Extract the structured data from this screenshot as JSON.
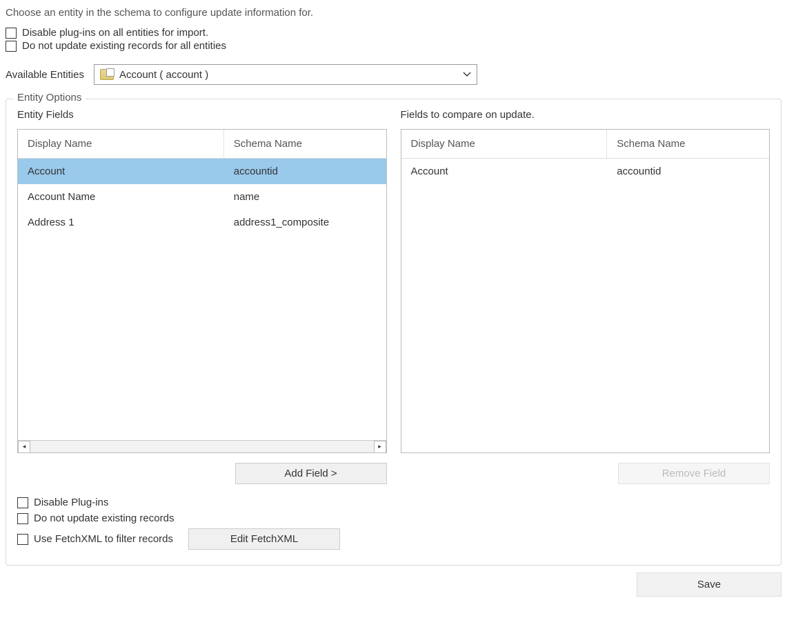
{
  "instruction": "Choose an entity in the schema to configure update information for.",
  "top_checks": {
    "disable_plugins_all": "Disable plug-ins on all entities for import.",
    "no_update_all": "Do not update existing records for all entities"
  },
  "available_entities": {
    "label": "Available Entities",
    "selected": "Account  ( account )"
  },
  "fieldset": {
    "legend": "Entity Options",
    "left": {
      "title": "Entity Fields",
      "headers": {
        "display": "Display Name",
        "schema": "Schema Name"
      },
      "rows": [
        {
          "display": "Account",
          "schema": "accountid",
          "selected": true
        },
        {
          "display": "Account Name",
          "schema": "name",
          "selected": false
        },
        {
          "display": "Address 1",
          "schema": "address1_composite",
          "selected": false
        }
      ],
      "button": "Add Field >"
    },
    "right": {
      "title": "Fields to compare on update.",
      "headers": {
        "display": "Display Name",
        "schema": "Schema Name"
      },
      "rows": [
        {
          "display": "Account",
          "schema": "accountid"
        }
      ],
      "button": "Remove Field",
      "button_disabled": true
    },
    "options": {
      "disable_plugins": "Disable Plug-ins",
      "no_update": "Do not update existing records",
      "use_fetchxml": "Use FetchXML to filter records",
      "edit_fetchxml": "Edit FetchXML"
    }
  },
  "save": "Save"
}
